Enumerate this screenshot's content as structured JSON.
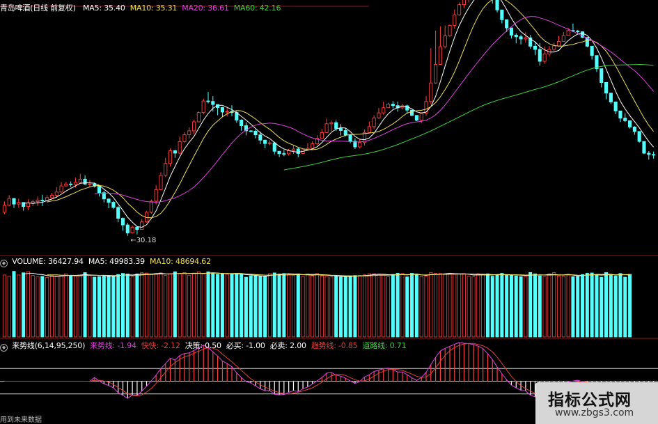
{
  "headers": {
    "main": {
      "title": "青岛啤酒(日线 前复权)",
      "items": [
        {
          "label": "MA5: 35.40",
          "color": "#ffffff"
        },
        {
          "label": "MA10: 35.31",
          "color": "#f0e060"
        },
        {
          "label": "MA20: 36.61",
          "color": "#e040e0"
        },
        {
          "label": "MA60: 42.16",
          "color": "#40d040"
        }
      ]
    },
    "volume": {
      "items": [
        {
          "label": "VOLUME: 36427.94",
          "color": "#ffffff"
        },
        {
          "label": "MA5: 49983.39",
          "color": "#ffffff"
        },
        {
          "label": "MA10: 48694.62",
          "color": "#f0e060"
        }
      ]
    },
    "indicator": {
      "items": [
        {
          "label": "来势线(6,14,95,250)",
          "color": "#ffffff"
        },
        {
          "label": "来势线: -1.94",
          "color": "#e040e0"
        },
        {
          "label": "快快: -2.12",
          "color": "#e04040"
        },
        {
          "label": "决策: 0.50",
          "color": "#ffffff"
        },
        {
          "label": "必买: -1.00",
          "color": "#ffffff"
        },
        {
          "label": "必卖: 2.00",
          "color": "#ffffff"
        },
        {
          "label": "趋势线: -0.85",
          "color": "#e04040"
        },
        {
          "label": "道路线: 0.71",
          "color": "#40d040"
        }
      ]
    }
  },
  "footer_text": "用到未来数据",
  "watermark": {
    "title": "指标公式网",
    "url": "www.zbgs3.com"
  },
  "chart_data": {
    "type": "candlestick",
    "ylim": [
      29,
      44
    ],
    "annotations": [
      {
        "label": "30.18",
        "price": 30.18
      }
    ],
    "colors": {
      "up": "#ff4040",
      "down": "#54ffff",
      "grid": "#8a1a1a"
    },
    "candles": [
      [
        31.65,
        32.09,
        31.52,
        32.33
      ],
      [
        32.09,
        32.51,
        32.01,
        32.72
      ],
      [
        32.51,
        32.16,
        31.92,
        32.52
      ],
      [
        32.16,
        32.26,
        31.93,
        32.5
      ],
      [
        32.26,
        32.01,
        31.75,
        32.27
      ],
      [
        32.01,
        32.23,
        31.78,
        32.46
      ],
      [
        32.23,
        32.31,
        32.04,
        32.44
      ],
      [
        32.31,
        32.41,
        32.04,
        32.62
      ],
      [
        32.41,
        32.38,
        32.04,
        32.74
      ],
      [
        32.38,
        32.56,
        32.27,
        32.72
      ],
      [
        32.56,
        32.71,
        32.51,
        32.86
      ],
      [
        32.71,
        32.91,
        32.55,
        33.22
      ],
      [
        32.91,
        33.29,
        32.86,
        33.53
      ],
      [
        33.29,
        33.41,
        33.24,
        33.55
      ],
      [
        33.41,
        33.37,
        33.22,
        33.57
      ],
      [
        33.37,
        33.51,
        33.2,
        33.8
      ],
      [
        33.51,
        33.71,
        33.51,
        34.04
      ],
      [
        33.71,
        33.41,
        33.33,
        33.94
      ],
      [
        33.41,
        33.41,
        33.23,
        33.66
      ],
      [
        33.41,
        33.27,
        33.19,
        33.5
      ],
      [
        33.27,
        32.87,
        32.63,
        33.28
      ],
      [
        32.87,
        32.48,
        32.26,
        32.99
      ],
      [
        32.48,
        32.27,
        31.9,
        32.39
      ],
      [
        32.27,
        31.95,
        31.85,
        32.36
      ],
      [
        31.95,
        31.27,
        31.03,
        32.04
      ],
      [
        31.27,
        30.86,
        30.51,
        31.33
      ],
      [
        30.86,
        30.36,
        30.18,
        31.0
      ],
      [
        30.36,
        30.72,
        30.33,
        30.82
      ],
      [
        30.72,
        30.58,
        30.27,
        30.78
      ],
      [
        30.58,
        31.05,
        30.56,
        31.24
      ],
      [
        31.05,
        31.65,
        31.01,
        31.72
      ],
      [
        31.65,
        32.34,
        31.56,
        32.44
      ],
      [
        32.34,
        33.06,
        32.13,
        33.34
      ],
      [
        33.06,
        33.95,
        33.02,
        34.15
      ],
      [
        33.95,
        34.69,
        33.84,
        35.04
      ],
      [
        34.69,
        35.48,
        34.5,
        35.64
      ],
      [
        35.48,
        35.33,
        35.04,
        35.54
      ],
      [
        35.33,
        36.05,
        35.26,
        36.36
      ],
      [
        36.05,
        36.48,
        35.97,
        36.64
      ],
      [
        36.48,
        36.72,
        36.25,
        36.94
      ],
      [
        36.72,
        37.28,
        36.52,
        37.4
      ],
      [
        37.28,
        37.86,
        37.25,
        37.93
      ],
      [
        37.86,
        38.58,
        37.74,
        38.72
      ],
      [
        38.58,
        38.55,
        38.43,
        39.14
      ],
      [
        38.55,
        38.36,
        37.92,
        38.88
      ],
      [
        38.36,
        38.17,
        37.69,
        38.31
      ],
      [
        38.17,
        37.89,
        37.56,
        38.21
      ],
      [
        37.89,
        37.93,
        37.63,
        38.2
      ],
      [
        37.93,
        37.86,
        37.64,
        38.31
      ],
      [
        37.86,
        37.39,
        37.22,
        37.95
      ],
      [
        37.39,
        37.04,
        36.73,
        37.44
      ],
      [
        37.04,
        36.72,
        36.44,
        37.25
      ],
      [
        36.72,
        36.7,
        36.62,
        36.75
      ],
      [
        36.7,
        36.47,
        36.25,
        36.8
      ],
      [
        36.47,
        36.14,
        35.89,
        36.66
      ],
      [
        36.14,
        35.93,
        35.64,
        36.18
      ],
      [
        35.93,
        35.97,
        35.83,
        36.13
      ],
      [
        35.97,
        35.45,
        35.26,
        36.04
      ],
      [
        35.45,
        35.3,
        35.09,
        35.36
      ],
      [
        35.3,
        35.29,
        35.14,
        35.53
      ],
      [
        35.29,
        35.49,
        35.18,
        35.61
      ],
      [
        35.49,
        35.59,
        35.28,
        35.82
      ],
      [
        35.59,
        35.31,
        35.07,
        35.69
      ],
      [
        35.31,
        35.54,
        35.31,
        35.59
      ],
      [
        35.54,
        35.63,
        35.5,
        35.96
      ],
      [
        35.63,
        35.91,
        35.67,
        36.07
      ],
      [
        35.91,
        36.25,
        35.86,
        36.44
      ],
      [
        36.25,
        36.61,
        36.42,
        36.83
      ],
      [
        36.61,
        37.16,
        36.71,
        37.48
      ],
      [
        37.16,
        37.23,
        36.71,
        37.36
      ],
      [
        37.23,
        36.87,
        36.71,
        37.37
      ],
      [
        36.87,
        36.74,
        36.43,
        37.14
      ],
      [
        36.74,
        36.46,
        36.38,
        36.9
      ],
      [
        36.46,
        36.07,
        35.95,
        36.52
      ],
      [
        36.07,
        35.72,
        35.59,
        36.26
      ],
      [
        35.72,
        35.99,
        35.64,
        36.19
      ],
      [
        35.99,
        36.62,
        35.82,
        36.81
      ],
      [
        36.62,
        36.98,
        36.58,
        37.3
      ],
      [
        36.98,
        37.53,
        36.82,
        37.69
      ],
      [
        37.53,
        37.84,
        37.46,
        38.15
      ],
      [
        37.84,
        38.16,
        37.72,
        38.54
      ],
      [
        38.16,
        38.38,
        38.14,
        38.47
      ],
      [
        38.38,
        38.29,
        38.13,
        38.57
      ],
      [
        38.29,
        38.15,
        37.91,
        38.54
      ],
      [
        38.15,
        38.28,
        38.05,
        38.41
      ],
      [
        38.28,
        38.01,
        37.8,
        38.35
      ],
      [
        38.01,
        37.68,
        37.64,
        37.91
      ],
      [
        37.68,
        37.38,
        37.32,
        37.53
      ],
      [
        37.38,
        37.81,
        37.2,
        37.87
      ],
      [
        37.81,
        38.55,
        37.67,
        38.88
      ],
      [
        38.55,
        39.7,
        38.39,
        41.87
      ],
      [
        39.7,
        40.86,
        39.65,
        42.97
      ],
      [
        40.86,
        41.96,
        40.84,
        43.22
      ],
      [
        41.96,
        42.63,
        41.85,
        43.28
      ],
      [
        42.63,
        43.29,
        42.58,
        43.34
      ],
      [
        43.29,
        43.95,
        43.09,
        44.28
      ],
      [
        43.95,
        44.58,
        43.88,
        44.72
      ],
      [
        44.58,
        44.88,
        44.37,
        45.1
      ],
      [
        44.88,
        45.22,
        44.71,
        45.71
      ],
      [
        45.22,
        45.47,
        45.07,
        45.94
      ],
      [
        45.47,
        45.64,
        45.37,
        45.66
      ],
      [
        45.64,
        45.68,
        45.64,
        45.71
      ],
      [
        45.68,
        45.38,
        45.17,
        45.56
      ],
      [
        45.38,
        44.94,
        44.64,
        45.09
      ],
      [
        44.94,
        44.25,
        44.1,
        44.41
      ],
      [
        44.25,
        43.64,
        43.41,
        43.81
      ],
      [
        43.64,
        43.13,
        42.88,
        43.27
      ],
      [
        43.13,
        42.68,
        42.47,
        42.83
      ],
      [
        42.68,
        42.58,
        42.17,
        42.79
      ],
      [
        42.58,
        42.44,
        42.1,
        42.71
      ],
      [
        42.44,
        42.51,
        42.21,
        42.86
      ],
      [
        42.51,
        41.99,
        41.84,
        42.69
      ],
      [
        41.99,
        41.79,
        41.45,
        42.25
      ],
      [
        41.79,
        41.05,
        40.78,
        42.19
      ],
      [
        41.05,
        41.5,
        40.9,
        41.98
      ],
      [
        41.5,
        41.79,
        41.34,
        42.0
      ],
      [
        41.79,
        42.01,
        41.68,
        42.21
      ],
      [
        42.01,
        42.29,
        42.03,
        42.63
      ],
      [
        42.29,
        42.65,
        42.28,
        42.88
      ],
      [
        42.65,
        42.97,
        42.8,
        43.13
      ],
      [
        42.97,
        42.93,
        42.86,
        43.4
      ],
      [
        42.93,
        42.89,
        42.79,
        43.01
      ],
      [
        42.89,
        42.54,
        42.5,
        42.79
      ],
      [
        42.54,
        41.99,
        41.93,
        42.06
      ],
      [
        41.99,
        41.41,
        41.16,
        41.59
      ],
      [
        41.41,
        40.59,
        40.39,
        40.86
      ],
      [
        40.59,
        39.73,
        39.42,
        40.05
      ],
      [
        39.73,
        39.07,
        38.69,
        39.33
      ],
      [
        39.07,
        38.52,
        38.39,
        38.56
      ],
      [
        38.52,
        37.96,
        37.76,
        38.09
      ],
      [
        37.96,
        37.51,
        37.27,
        37.74
      ],
      [
        37.51,
        37.35,
        37.27,
        37.8
      ],
      [
        37.35,
        36.96,
        36.86,
        37.32
      ],
      [
        36.96,
        36.68,
        36.48,
        37.01
      ],
      [
        36.68,
        36.06,
        35.99,
        36.3
      ],
      [
        36.06,
        35.33,
        35.27,
        35.82
      ],
      [
        35.33,
        35.25,
        34.93,
        35.46
      ],
      [
        35.25,
        35.22,
        34.99,
        35.43
      ]
    ],
    "volume": [
      4958,
      4851,
      5253,
      4960,
      5138,
      5232,
      4924,
      4807,
      4851,
      4772,
      4912,
      4868,
      4940,
      5052,
      4908,
      4898,
      4957,
      5153,
      4914,
      4793,
      4830,
      4900,
      4909,
      4860,
      4997,
      5090,
      5037,
      4806,
      5044,
      5144,
      5116,
      5045,
      5032,
      5134,
      4928,
      5070,
      5217,
      5057,
      5162,
      4947,
      5117,
      5224,
      5039,
      5208,
      5094,
      5022,
      5055,
      5018,
      5052,
      5088,
      5006,
      4786,
      4894,
      4894,
      4870,
      4863,
      5076,
      5129,
      5036,
      5078,
      5004,
      4948,
      5048,
      4849,
      5039,
      4893,
      5079,
      4891,
      4865,
      4803,
      4886,
      4804,
      4883,
      4849,
      4920,
      4932,
      4963,
      5064,
      5069,
      5035,
      4946,
      4823,
      5006,
      5101,
      5086,
      4810,
      5097,
      5037,
      4828,
      4883,
      5163,
      5097,
      5082,
      5034,
      5108,
      5019,
      5035,
      5064,
      4862,
      4809,
      5063,
      5037,
      5055,
      4861,
      4961,
      5094,
      4984,
      4956,
      4889,
      4823,
      4878,
      5163,
      5053,
      4890,
      4839,
      5044,
      5151,
      4890,
      4884,
      5020,
      4830,
      4841,
      4994,
      5099,
      5125,
      4995,
      4784,
      5156,
      5004,
      4887,
      5082,
      4789,
      5011
    ],
    "indicator": {
      "ylim": [
        -3,
        4
      ],
      "lines": [
        {
          "label": "2.00",
          "value": 2.0
        },
        {
          "label": "0.50",
          "value": 0.5
        },
        {
          "label": "-1.00",
          "value": -1.0
        }
      ]
    }
  }
}
